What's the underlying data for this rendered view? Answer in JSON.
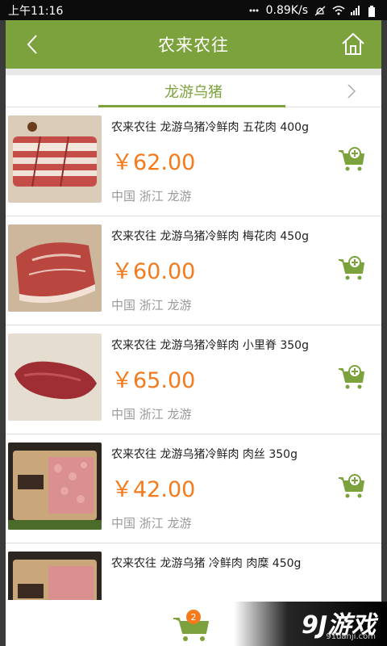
{
  "status_bar": {
    "time": "上午11:16",
    "speed": "0.89K/s"
  },
  "header": {
    "title": "农来农往"
  },
  "tab": {
    "label": "龙游乌猪"
  },
  "products": [
    {
      "name": "农来农往 龙游乌猪冷鲜肉 五花肉 400g",
      "price": "￥62.00",
      "origin": "中国 浙江 龙游"
    },
    {
      "name": "农来农往 龙游乌猪冷鲜肉 梅花肉 450g",
      "price": "￥60.00",
      "origin": "中国 浙江 龙游"
    },
    {
      "name": "农来农往 龙游乌猪冷鲜肉 小里脊 350g",
      "price": "￥65.00",
      "origin": "中国 浙江 龙游"
    },
    {
      "name": "农来农往 龙游乌猪冷鲜肉 肉丝 350g",
      "price": "￥42.00",
      "origin": "中国 浙江 龙游"
    },
    {
      "name": "农来农往 龙游乌猪 冷鲜肉 肉糜 450g",
      "price": "",
      "origin": ""
    }
  ],
  "cart": {
    "count": "2"
  },
  "watermark": {
    "logo": "9J游戏",
    "url": "91danji.com"
  },
  "colors": {
    "accent": "#7ba23c",
    "price": "#f47a1c"
  }
}
